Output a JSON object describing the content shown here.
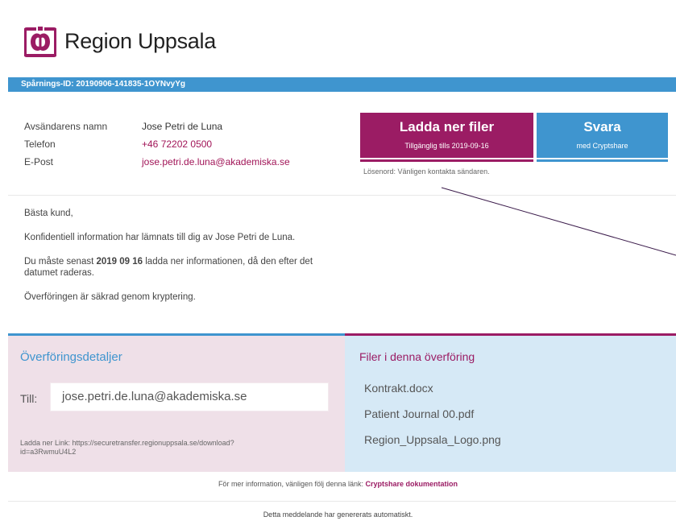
{
  "header": {
    "logo_icon": "region-uppsala-logo",
    "org_name": "Region Uppsala"
  },
  "tracking": {
    "label": "Spårnings-ID: 20190906-141835-1OYNvyYg"
  },
  "sender": {
    "name_label": "Avsändarens namn",
    "name_value": "Jose Petri de Luna",
    "phone_label": "Telefon",
    "phone_value": "+46 72202 0500",
    "email_label": "E-Post",
    "email_value": "jose.petri.de.luna@akademiska.se"
  },
  "actions": {
    "download_label": "Ladda ner filer",
    "download_sub": "Tillgänglig tills 2019-09-16",
    "reply_label": "Svara",
    "reply_sub": "med Cryptshare",
    "password_hint": "Lösenord: Vänligen kontakta sändaren.",
    "download_color": "#9b1c64",
    "reply_color": "#3f95cf"
  },
  "message": {
    "greeting": "Bästa kund,",
    "line1": "Konfidentiell information har lämnats till dig av Jose Petri de Luna.",
    "line2_pre": "Du måste senast ",
    "line2_date": "2019 09 16",
    "line2_post": " ladda ner informationen, då den efter det datumet raderas.",
    "line3": "Överföringen är säkrad genom kryptering."
  },
  "transfer": {
    "title": "Överföringsdetaljer",
    "to_label": "Till:",
    "to_value": "jose.petri.de.luna@akademiska.se",
    "download_link": "Ladda ner Link: https://securetransfer.regionuppsala.se/download?id=a3RwmuU4L2"
  },
  "files": {
    "title": "Filer i denna överföring",
    "items": [
      "Kontrakt.docx",
      "Patient Journal 00.pdf",
      "Region_Uppsala_Logo.png"
    ]
  },
  "footer": {
    "info_text": "För mer information, vänligen följ denna länk: ",
    "info_link": "Cryptshare dokumentation",
    "auto_text": "Detta meddelande har genererats automatiskt."
  }
}
